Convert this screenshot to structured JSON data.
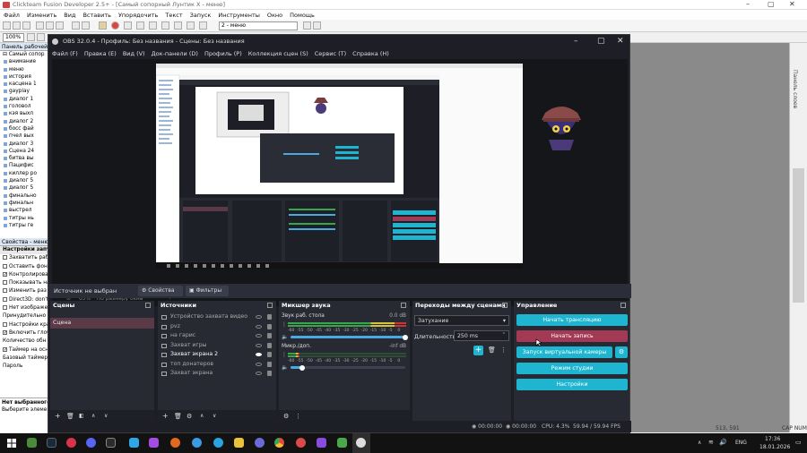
{
  "clickteam": {
    "title": "Clickteam Fusion Developer 2.5+ - [Самый сопорный Лунтик X - меню]",
    "menu": [
      "Файл",
      "Изменить",
      "Вид",
      "Вставить",
      "Упорядочить",
      "Текст",
      "Запуск",
      "Инструменты",
      "Окно",
      "Помощь"
    ],
    "zoom": "100%",
    "frame_combo": "2 - меню",
    "workspace_header": "Панель рабочей обл",
    "tree_root": "Самый сопор",
    "tree_items": [
      "внимание",
      "меню",
      "история",
      "касцена 1",
      "gayplay",
      "диалог 1",
      "головол",
      "кэя выхл",
      "диалог 2",
      "босс фай",
      "пчел вых",
      "диалог 3",
      "Сцена 24",
      "битва вы",
      "Пацифис",
      "киллер ро",
      "диалог 5",
      "диалог 5",
      "финально",
      "финальн",
      "выстрел",
      "титры нь",
      "титры ге"
    ],
    "props_header": "Свойства - меню",
    "props_rows": [
      {
        "label": "Настройки запуска",
        "section": true
      },
      {
        "label": "Захватить рабо",
        "check": false
      },
      {
        "label": "Оставить фон",
        "check": false
      },
      {
        "label": "Контролировал",
        "check": true
      },
      {
        "label": "Показывать на",
        "check": false
      },
      {
        "label": "Изменить раз",
        "check": false
      },
      {
        "label": "Direct3D: don't",
        "check": false
      },
      {
        "label": "Нет изображен",
        "check": false
      },
      {
        "label": "Принудительно",
        "check": null
      },
      {
        "label": "Настройки кра",
        "check": false
      },
      {
        "label": "Включить глоб",
        "check": true
      },
      {
        "label": "Количество обн",
        "check": null
      },
      {
        "label": "Таймер на осн",
        "check": true
      },
      {
        "label": "Базовый таймер д",
        "check": null
      },
      {
        "label": "Пароль",
        "check": null
      }
    ],
    "props_footer_title": "Нет выбранного э",
    "props_footer_text": "Выберите элемент,",
    "side_label": "Панель слоев",
    "coords": "513, 591",
    "caps": "CAP NUM"
  },
  "obs": {
    "title": "OBS 32.0.4 - Профиль: Без названия - Сцены: Без названия",
    "menu": [
      "Файл (F)",
      "Правка (E)",
      "Вид (V)",
      "Док-панели (D)",
      "Профиль (P)",
      "Коллекция сцен (S)",
      "Сервис (T)",
      "Справка (H)"
    ],
    "zoom_label": "65%",
    "zoom_fit": "По размеру окна",
    "source_none": "Источник не выбран",
    "properties_btn": "Свойства",
    "filters_btn": "Фильтры",
    "scenes": {
      "title": "Сцены",
      "items": [
        "Сцена"
      ]
    },
    "sources": {
      "title": "Источники",
      "items": [
        {
          "label": "Устройство захвата видео",
          "visible": false
        },
        {
          "label": "pvz",
          "visible": false
        },
        {
          "label": "на гарис",
          "visible": false
        },
        {
          "label": "Захват игры",
          "visible": false
        },
        {
          "label": "Захват экрана 2",
          "visible": true
        },
        {
          "label": "топ донатеров",
          "visible": false
        },
        {
          "label": "Захват экрана",
          "visible": false
        }
      ]
    },
    "mixer": {
      "title": "Микшер звука",
      "channels": [
        {
          "name": "Звук раб. стола",
          "db": "0.0 dB",
          "level": 1.0
        },
        {
          "name": "Микр./доп.",
          "db": "-inf dB",
          "level": 0.1
        }
      ],
      "scale": [
        "-60",
        "-55",
        "-50",
        "-45",
        "-40",
        "-35",
        "-30",
        "-25",
        "-20",
        "-15",
        "-10",
        "-5",
        "0"
      ]
    },
    "transitions": {
      "title": "Переходы между сценами",
      "type": "Затухание",
      "duration_label": "Длительность",
      "duration": "250 ms"
    },
    "controls": {
      "title": "Управление",
      "start_stream": "Начать трансляцию",
      "start_rec": "Начать запись",
      "virtual_cam": "Запуск виртуальной камеры",
      "studio": "Режим студии",
      "settings": "Настройки"
    },
    "status": {
      "t1": "00:00:00",
      "t2": "00:00:00",
      "cpu": "CPU: 4.3%",
      "fps": "59.94 / 59.94 FPS"
    }
  },
  "taskbar": {
    "lang": "ENG",
    "time": "17:36",
    "date": "18.01.2026"
  },
  "colors": {
    "obs_bg": "#1e1f26",
    "obs_dock": "#272a33",
    "accent": "#1fb4cf",
    "record": "#a33a55"
  }
}
